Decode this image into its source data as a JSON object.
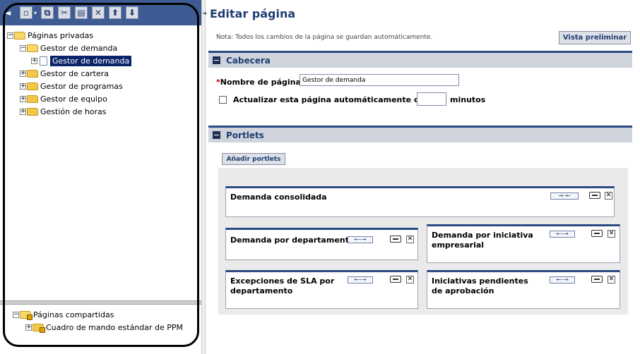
{
  "left_tree": {
    "private_pages_label": "Páginas privadas",
    "shared_pages_label": "Páginas compartidas",
    "items": [
      {
        "label": "Gestor de demanda"
      },
      {
        "label": "Gestor de demanda",
        "selected": true
      },
      {
        "label": "Gestor de cartera"
      },
      {
        "label": "Gestor de programas"
      },
      {
        "label": "Gestor de equipo"
      },
      {
        "label": "Gestión de horas"
      }
    ],
    "shared_item": "Cuadro de mando estándar de PPM"
  },
  "header": {
    "title": "Editar página",
    "note": "Nota: Todos los cambios de la página se guardan automáticamente.",
    "preview_button": "Vista preliminar"
  },
  "cabecera": {
    "section_title": "Cabecera",
    "required_mark": "*",
    "page_name_label": "Nombre de página:",
    "page_name_value": "Gestor de demanda",
    "refresh_label": "Actualizar esta página automáticamente cada",
    "refresh_value": "",
    "minutes_label": "minutos",
    "refresh_checked": false
  },
  "portlets": {
    "section_title": "Portlets",
    "add_button": "Añadir portlets",
    "items": [
      {
        "title": "Demanda consolidada"
      },
      {
        "title": "Demanda por departamento"
      },
      {
        "title": "Demanda por iniciativa empresarial"
      },
      {
        "title": "Excepciones de SLA por departamento"
      },
      {
        "title": "Iniciativas pendientes de aprobación"
      }
    ]
  },
  "colors": {
    "toolbar_bg": "#3e5b93",
    "section_border": "#2b4a82",
    "title_color": "#1f3d73",
    "selection_bg": "#0a246a"
  }
}
